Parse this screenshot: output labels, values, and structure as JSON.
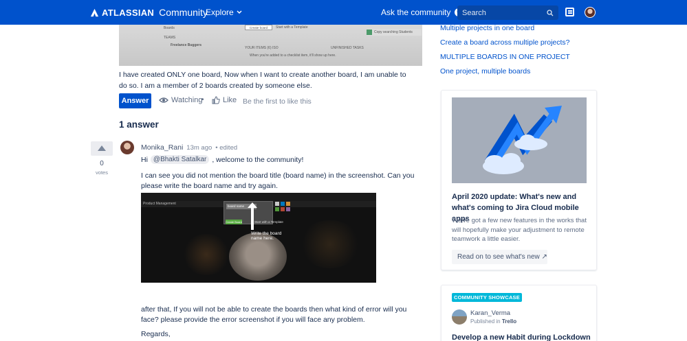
{
  "nav": {
    "brand": "ATLASSIAN",
    "brand_sub": "Community",
    "explore": "Explore",
    "ask": "Ask the community",
    "search_placeholder": "Search"
  },
  "question": {
    "screenshot_texts": {
      "create_board": "Create board",
      "start_template": "Start with a Template",
      "teams": "TEAMS",
      "team_name": "Freelance Buggers",
      "boards": "Boards",
      "board_item": "Copy searching Students",
      "your_items": "YOUR ITEMS (6) ISO",
      "hint": "When you're added to a checklist item, it'll show up here.",
      "tasks": "UNFINISHED TASKS"
    },
    "body": "I have created ONLY one board, Now when I want to create another board, I am unable to do so. I am a member of 2 boards created by someone else.",
    "answer_label": "Answer",
    "watching_label": "Watching",
    "separator": "•",
    "like_label": "Like",
    "first_like": "Be the first to like this"
  },
  "answers": {
    "heading": "1 answer",
    "items": [
      {
        "votes": "0",
        "votes_label": "votes",
        "author": "Monika_Rani",
        "time": "13m ago",
        "edited": "• edited",
        "greeting": "Hi",
        "mention": "@Bhakti Satalkar",
        "welcome": ", welcome to the community!",
        "para1": "I can see you did not mention the board title (board name) in the screenshot. Can you please write the board name and try again.",
        "screenshot": {
          "board_label": "Product Management",
          "input_text": "board name",
          "create_btn": "Create Board",
          "template_text": "Start with a Template",
          "note": "Write the board name here."
        },
        "para2": "after that, If you will not be able to create the boards then what kind of error will you face? please provide the error screenshot if you will face any problem.",
        "signoff": "Regards,"
      }
    ]
  },
  "sidebar": {
    "related": [
      "Multiple projects in one board",
      "Create a board across multiple projects?",
      "MULTIPLE BOARDS IN ONE PROJECT",
      "One project, multiple boards"
    ],
    "card1": {
      "title": "April 2020 update: What's new and what's coming to Jira Cloud mobile apps",
      "description": "We've got a few new features in the works that will hopefully make your adjustment to remote teamwork a little easier.",
      "button": "Read on to see what's new ↗"
    },
    "card2": {
      "badge": "COMMUNITY SHOWCASE",
      "author": "Karan_Verma",
      "published_in": "Published in",
      "product": "Trello",
      "title": "Develop a new Habit during Lockdown"
    }
  },
  "colors": {
    "brand_blue": "#0052cc",
    "showcase_teal": "#00b8d9"
  }
}
